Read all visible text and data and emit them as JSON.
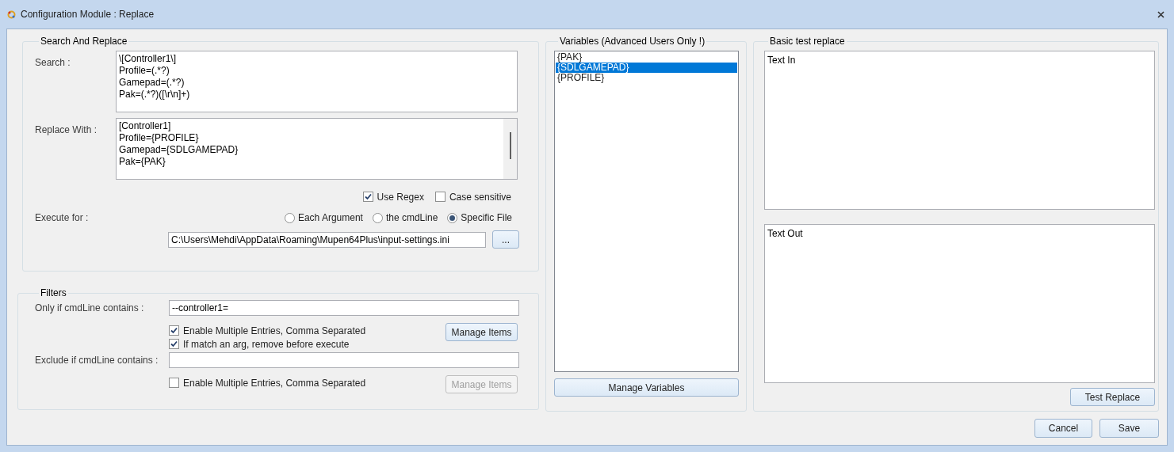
{
  "window": {
    "title": "Configuration Module : Replace"
  },
  "search_and_replace": {
    "title": "Search And Replace",
    "search": {
      "label": "Search :",
      "value": "\\[Controller1\\]\nProfile=(.*?)\nGamepad=(.*?)\nPak=(.*?)([\\r\\n]+)"
    },
    "replace": {
      "label": "Replace With :",
      "value": "[Controller1]\nProfile={PROFILE}\nGamepad={SDLGAMEPAD}\nPak={PAK}"
    },
    "options": [
      {
        "label": "Use Regex",
        "checked": true
      },
      {
        "label": "Case sensitive",
        "checked": false
      }
    ],
    "execute_for": {
      "label": "Execute for :",
      "options": [
        {
          "label": "Each Argument",
          "selected": false
        },
        {
          "label": "the cmdLine",
          "selected": false
        },
        {
          "label": "Specific File",
          "selected": true
        }
      ]
    },
    "file_path": {
      "value": "C:\\Users\\Mehdi\\AppData\\Roaming\\Mupen64Plus\\input-settings.ini",
      "button": "..."
    }
  },
  "filters": {
    "title": "Filters",
    "include": {
      "label": "Only if cmdLine contains :",
      "value": "--controller1=",
      "options": [
        {
          "label": "Enable Multiple Entries, Comma Separated",
          "checked": true
        },
        {
          "label": "If match an arg, remove before execute",
          "checked": true
        }
      ],
      "button": {
        "label": "Manage Items",
        "disabled": false
      }
    },
    "exclude": {
      "label": "Exclude if cmdLine contains :",
      "options": [
        {
          "label": "Enable Multiple Entries, Comma Separated",
          "checked": false
        }
      ],
      "button": {
        "label": "Manage Items",
        "disabled": true
      }
    }
  },
  "variables": {
    "title": "Variables (Advanced Users Only !)",
    "items": [
      {
        "label": "{PAK}",
        "selected": false
      },
      {
        "label": "{SDLGAMEPAD}",
        "selected": true
      },
      {
        "label": "{PROFILE}",
        "selected": false
      }
    ],
    "button": "Manage Variables"
  },
  "basic_test": {
    "title": "Basic test replace",
    "text_in": "Text In",
    "text_out": "Text Out",
    "button": "Test Replace"
  },
  "buttons": [
    "Cancel",
    "Save"
  ]
}
